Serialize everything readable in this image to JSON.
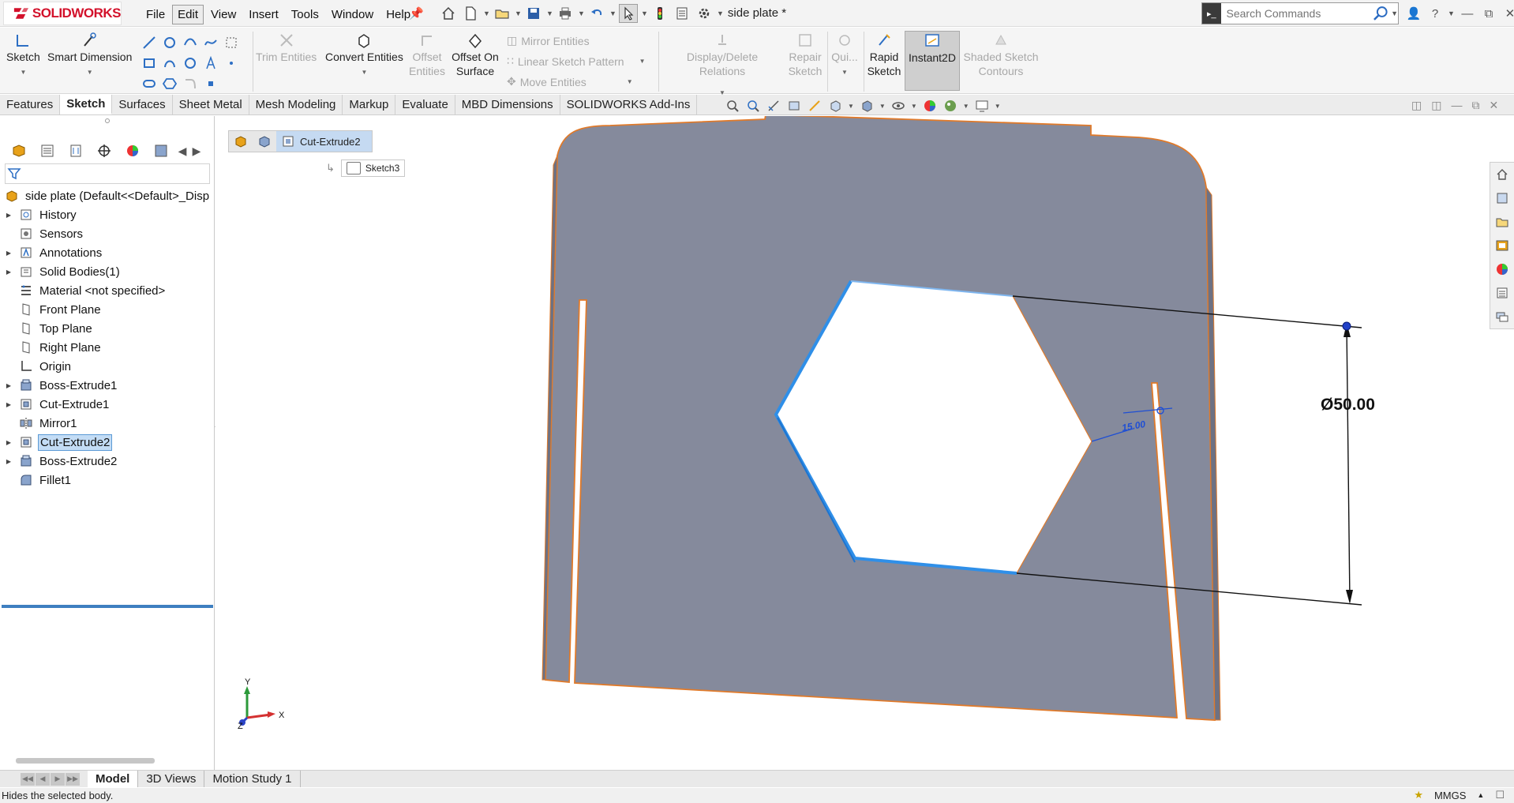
{
  "app": {
    "logo_text": "SOLIDWORKS",
    "document_title": "side plate *",
    "menu": [
      "File",
      "Edit",
      "View",
      "Insert",
      "Tools",
      "Window",
      "Help"
    ],
    "active_menu": "Edit",
    "search_placeholder": "Search Commands",
    "accent_color": "#d3112b"
  },
  "command_manager": {
    "sketch_label": "Sketch",
    "smart_dimension_label": "Smart Dimension",
    "trim_entities_label": "Trim Entities",
    "convert_entities_label": "Convert Entities",
    "offset_entities_label": "Offset Entities",
    "offset_on_surface_label": "Offset On Surface",
    "mirror_entities_label": "Mirror Entities",
    "linear_sketch_pattern_label": "Linear Sketch Pattern",
    "move_entities_label": "Move Entities",
    "display_delete_relations_label": "Display/Delete Relations",
    "repair_sketch_label": "Repair Sketch",
    "quick_snaps_label": "Qui...",
    "rapid_sketch_label": "Rapid Sketch",
    "instant2d_label": "Instant2D",
    "shaded_sketch_contours_label": "Shaded Sketch Contours"
  },
  "tabs": [
    "Features",
    "Sketch",
    "Surfaces",
    "Sheet Metal",
    "Mesh Modeling",
    "Markup",
    "Evaluate",
    "MBD Dimensions",
    "SOLIDWORKS Add-Ins"
  ],
  "active_tab": "Sketch",
  "feature_tree": {
    "root": "side plate  (Default<<Default>_Disp",
    "items": [
      {
        "label": "History",
        "expandable": true,
        "icon": "history-icon"
      },
      {
        "label": "Sensors",
        "expandable": false,
        "icon": "sensors-icon"
      },
      {
        "label": "Annotations",
        "expandable": true,
        "icon": "annotations-icon"
      },
      {
        "label": "Solid Bodies(1)",
        "expandable": true,
        "icon": "solid-bodies-icon"
      },
      {
        "label": "Material <not specified>",
        "expandable": false,
        "icon": "material-icon"
      },
      {
        "label": "Front Plane",
        "expandable": false,
        "icon": "plane-icon"
      },
      {
        "label": "Top Plane",
        "expandable": false,
        "icon": "plane-icon"
      },
      {
        "label": "Right Plane",
        "expandable": false,
        "icon": "plane-icon"
      },
      {
        "label": "Origin",
        "expandable": false,
        "icon": "origin-icon"
      },
      {
        "label": "Boss-Extrude1",
        "expandable": true,
        "icon": "boss-extrude-icon"
      },
      {
        "label": "Cut-Extrude1",
        "expandable": true,
        "icon": "cut-extrude-icon"
      },
      {
        "label": "Mirror1",
        "expandable": false,
        "icon": "mirror-icon"
      },
      {
        "label": "Cut-Extrude2",
        "expandable": true,
        "icon": "cut-extrude-icon",
        "selected": true
      },
      {
        "label": "Boss-Extrude2",
        "expandable": true,
        "icon": "boss-extrude-icon"
      },
      {
        "label": "Fillet1",
        "expandable": false,
        "icon": "fillet-icon"
      }
    ]
  },
  "breadcrumb": {
    "current": "Cut-Extrude2",
    "child": "Sketch3"
  },
  "graphics": {
    "dimension_label": "Ø50.00",
    "small_dimension_label": "15.00",
    "triad_labels": {
      "x": "X",
      "y": "Y",
      "z": "Z"
    },
    "body_color": "#858a9c",
    "edge_color": "#e07a2a",
    "selection_color": "#2f8fe8"
  },
  "bottom_tabs": [
    "Model",
    "3D Views",
    "Motion Study 1"
  ],
  "active_bottom_tab": "Model",
  "status": {
    "message": "Hides the selected body.",
    "units": "MMGS"
  }
}
